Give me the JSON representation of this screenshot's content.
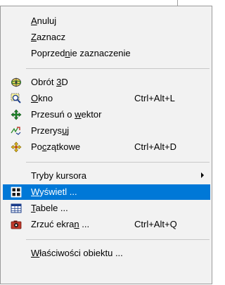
{
  "menu": {
    "items": [
      {
        "pre": "",
        "mn": "A",
        "post": "nuluj",
        "shortcut": ""
      },
      {
        "pre": "",
        "mn": "Z",
        "post": "aznacz",
        "shortcut": ""
      },
      {
        "pre": "Poprzed",
        "mn": "n",
        "post": "ie zaznaczenie",
        "shortcut": ""
      },
      {
        "pre": "Obrót ",
        "mn": "3",
        "post": "D",
        "shortcut": ""
      },
      {
        "pre": "",
        "mn": "O",
        "post": "kno",
        "shortcut": "Ctrl+Alt+L"
      },
      {
        "pre": "Przesuń o ",
        "mn": "w",
        "post": "ektor",
        "shortcut": ""
      },
      {
        "pre": "Przerys",
        "mn": "u",
        "post": "j",
        "shortcut": ""
      },
      {
        "pre": "Po",
        "mn": "c",
        "post": "zątkowe",
        "shortcut": "Ctrl+Alt+D"
      },
      {
        "pre": "Tryby kursora",
        "mn": "",
        "post": "",
        "shortcut": ""
      },
      {
        "pre": "",
        "mn": "W",
        "post": "yświetl ...",
        "shortcut": ""
      },
      {
        "pre": "",
        "mn": "T",
        "post": "abele ...",
        "shortcut": ""
      },
      {
        "pre": "Zrzuć ekra",
        "mn": "n",
        "post": " ...",
        "shortcut": "Ctrl+Alt+Q"
      },
      {
        "pre": "",
        "mn": "W",
        "post": "łaściwości obiektu ...",
        "shortcut": ""
      }
    ]
  },
  "icons": {
    "rotate3d": "rotate-3d-icon",
    "window": "zoom-window-icon",
    "move": "pan-move-icon",
    "redraw": "redraw-icon",
    "home": "home-view-icon",
    "display": "display-icon",
    "tables": "table-icon",
    "screenshot": "screenshot-camera-icon"
  },
  "colors": {
    "selection": "#0078d7",
    "menu_bg": "#f2f2f2",
    "border": "#9b9b9b"
  }
}
